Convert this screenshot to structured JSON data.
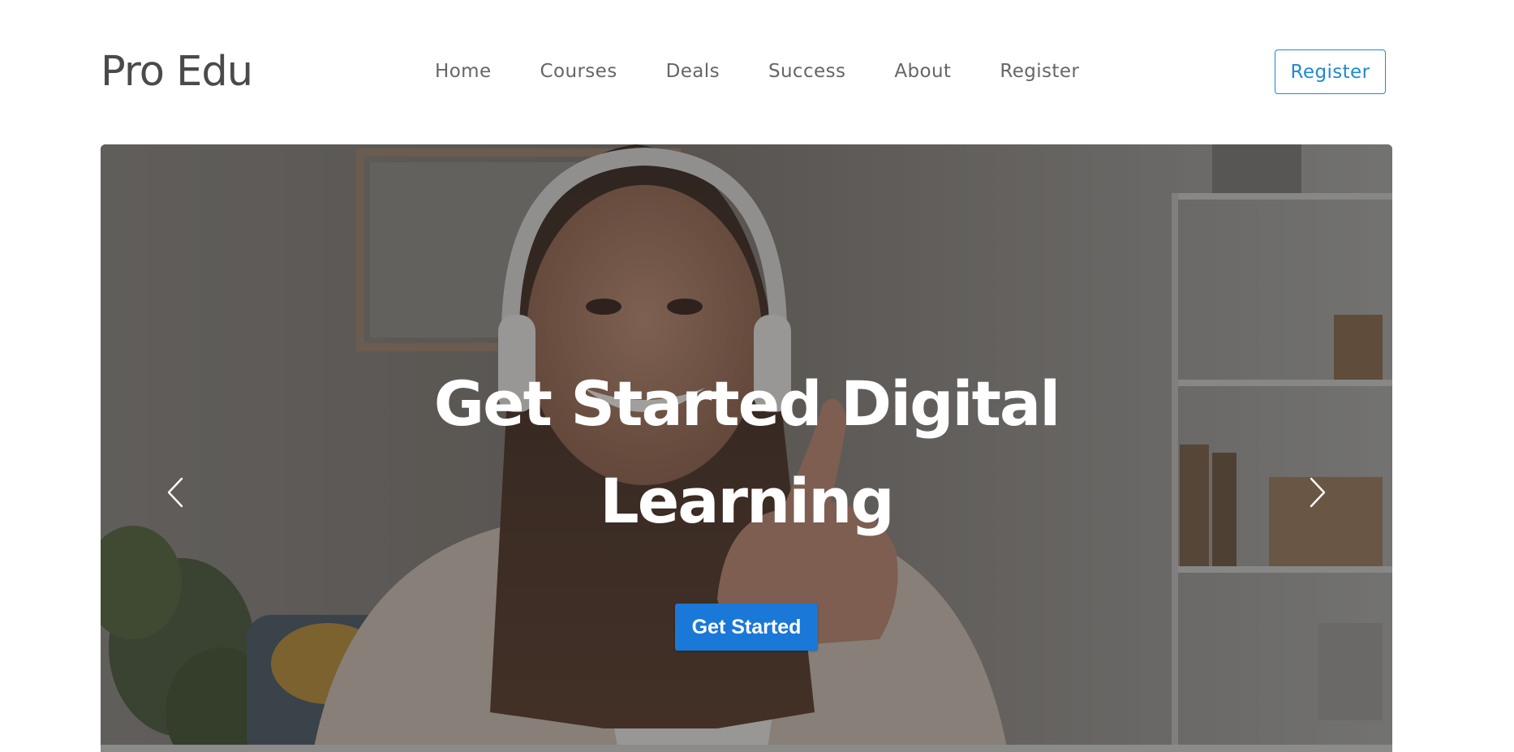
{
  "header": {
    "logo": "Pro Edu",
    "nav": [
      "Home",
      "Courses",
      "Deals",
      "Success",
      "About",
      "Register"
    ],
    "register_button": "Register"
  },
  "hero": {
    "title": "Get Started Digital Learning",
    "cta_label": "Get Started",
    "prev_icon": "chevron-left-icon",
    "next_icon": "chevron-right-icon"
  },
  "colors": {
    "accent": "#1d8ad2",
    "cta": "#1a78d8",
    "logo_text": "#4a4a4a",
    "nav_text": "#666666"
  }
}
